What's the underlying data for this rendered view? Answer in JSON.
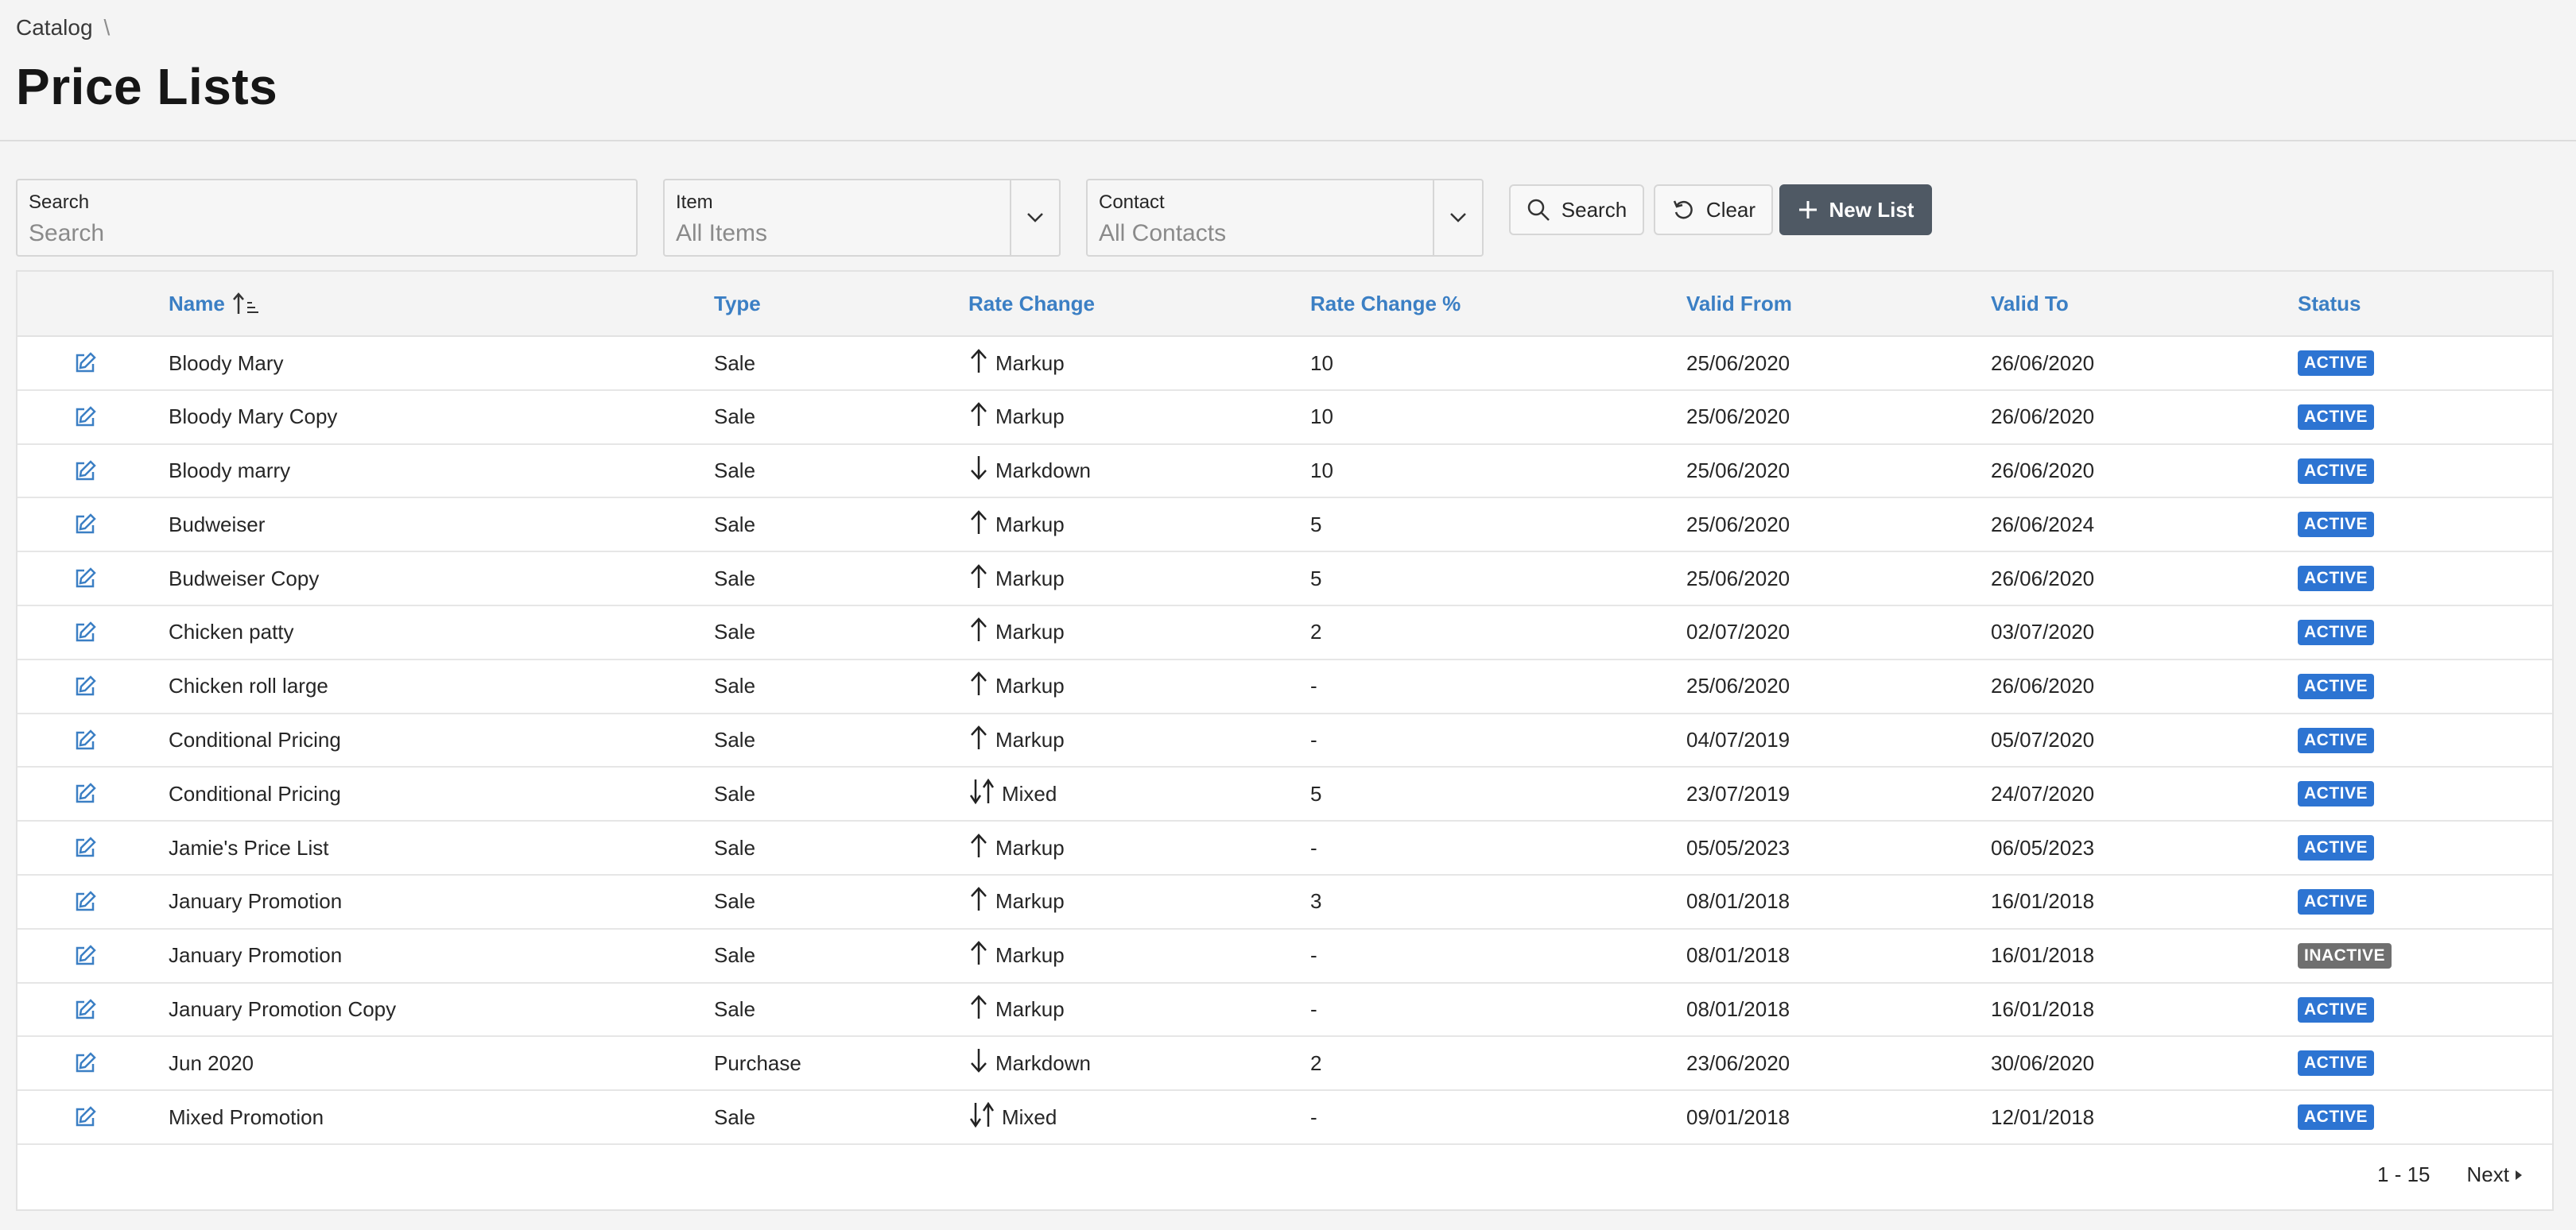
{
  "breadcrumb": {
    "parent": "Catalog",
    "separator": "\\"
  },
  "page_title": "Price Lists",
  "filters": {
    "search": {
      "label": "Search",
      "placeholder": "Search"
    },
    "item": {
      "label": "Item",
      "value": "All Items"
    },
    "contact": {
      "label": "Contact",
      "value": "All Contacts"
    }
  },
  "buttons": {
    "search": "Search",
    "clear": "Clear",
    "new_list": "New List"
  },
  "columns": {
    "name": "Name",
    "type": "Type",
    "rate_change": "Rate Change",
    "rate_change_pct": "Rate Change %",
    "valid_from": "Valid From",
    "valid_to": "Valid To",
    "status": "Status"
  },
  "rows": [
    {
      "name": "Bloody Mary",
      "type": "Sale",
      "direction": "up",
      "rate": "Markup",
      "pct": "10",
      "from": "25/06/2020",
      "to": "26/06/2020",
      "status": "ACTIVE"
    },
    {
      "name": "Bloody Mary Copy",
      "type": "Sale",
      "direction": "up",
      "rate": "Markup",
      "pct": "10",
      "from": "25/06/2020",
      "to": "26/06/2020",
      "status": "ACTIVE"
    },
    {
      "name": "Bloody marry",
      "type": "Sale",
      "direction": "down",
      "rate": "Markdown",
      "pct": "10",
      "from": "25/06/2020",
      "to": "26/06/2020",
      "status": "ACTIVE"
    },
    {
      "name": "Budweiser",
      "type": "Sale",
      "direction": "up",
      "rate": "Markup",
      "pct": "5",
      "from": "25/06/2020",
      "to": "26/06/2024",
      "status": "ACTIVE"
    },
    {
      "name": "Budweiser Copy",
      "type": "Sale",
      "direction": "up",
      "rate": "Markup",
      "pct": "5",
      "from": "25/06/2020",
      "to": "26/06/2020",
      "status": "ACTIVE"
    },
    {
      "name": "Chicken patty",
      "type": "Sale",
      "direction": "up",
      "rate": "Markup",
      "pct": "2",
      "from": "02/07/2020",
      "to": "03/07/2020",
      "status": "ACTIVE"
    },
    {
      "name": "Chicken roll large",
      "type": "Sale",
      "direction": "up",
      "rate": "Markup",
      "pct": "-",
      "from": "25/06/2020",
      "to": "26/06/2020",
      "status": "ACTIVE"
    },
    {
      "name": "Conditional Pricing",
      "type": "Sale",
      "direction": "up",
      "rate": "Markup",
      "pct": "-",
      "from": "04/07/2019",
      "to": "05/07/2020",
      "status": "ACTIVE"
    },
    {
      "name": "Conditional Pricing",
      "type": "Sale",
      "direction": "mixed",
      "rate": "Mixed",
      "pct": "5",
      "from": "23/07/2019",
      "to": "24/07/2020",
      "status": "ACTIVE"
    },
    {
      "name": "Jamie's Price List",
      "type": "Sale",
      "direction": "up",
      "rate": "Markup",
      "pct": "-",
      "from": "05/05/2023",
      "to": "06/05/2023",
      "status": "ACTIVE"
    },
    {
      "name": "January Promotion",
      "type": "Sale",
      "direction": "up",
      "rate": "Markup",
      "pct": "3",
      "from": "08/01/2018",
      "to": "16/01/2018",
      "status": "ACTIVE"
    },
    {
      "name": "January Promotion",
      "type": "Sale",
      "direction": "up",
      "rate": "Markup",
      "pct": "-",
      "from": "08/01/2018",
      "to": "16/01/2018",
      "status": "INACTIVE"
    },
    {
      "name": "January Promotion Copy",
      "type": "Sale",
      "direction": "up",
      "rate": "Markup",
      "pct": "-",
      "from": "08/01/2018",
      "to": "16/01/2018",
      "status": "ACTIVE"
    },
    {
      "name": "Jun 2020",
      "type": "Purchase",
      "direction": "down",
      "rate": "Markdown",
      "pct": "2",
      "from": "23/06/2020",
      "to": "30/06/2020",
      "status": "ACTIVE"
    },
    {
      "name": "Mixed Promotion",
      "type": "Sale",
      "direction": "mixed",
      "rate": "Mixed",
      "pct": "-",
      "from": "09/01/2018",
      "to": "12/01/2018",
      "status": "ACTIVE"
    }
  ],
  "pagination": {
    "range": "1 - 15",
    "next": "Next"
  },
  "colors": {
    "link": "#3b7fc4",
    "active": "#2d74d2",
    "inactive": "#6f6f6f",
    "primary": "#4f5964"
  }
}
